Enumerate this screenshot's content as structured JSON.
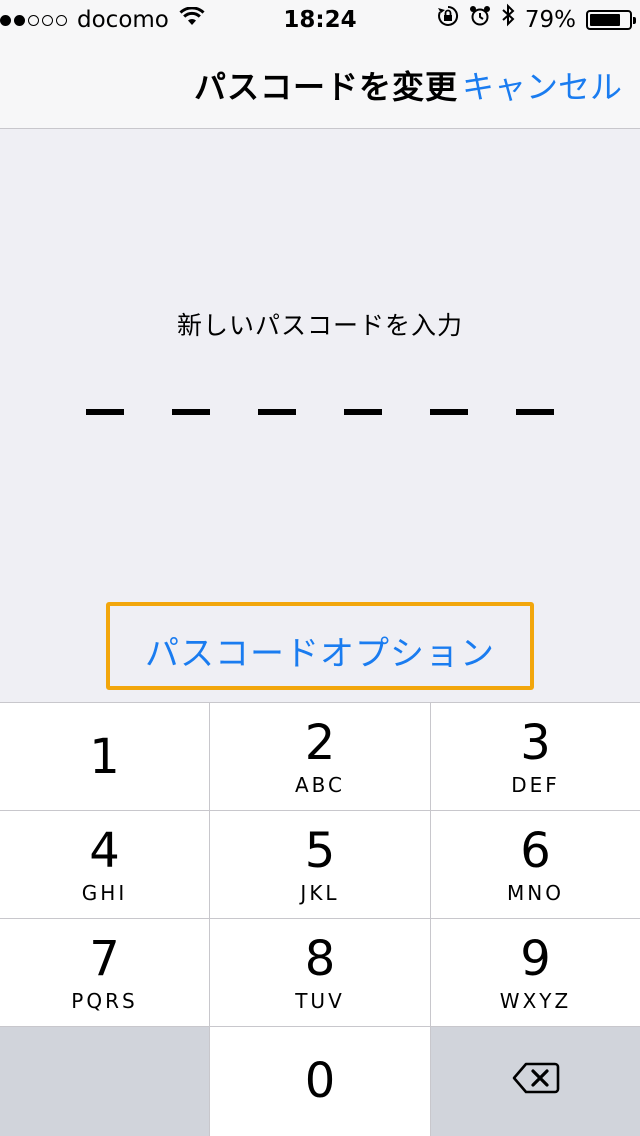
{
  "status_bar": {
    "carrier": "docomo",
    "signal_bars_filled": 2,
    "signal_bars_total": 5,
    "time": "18:24",
    "battery_percent_text": "79%",
    "battery_level": 0.79,
    "icons": [
      "wifi-icon",
      "rotation-lock-icon",
      "alarm-icon",
      "bluetooth-icon",
      "battery-icon"
    ]
  },
  "nav": {
    "title": "パスコードを変更",
    "cancel_label": "キャンセル"
  },
  "passcode": {
    "prompt": "新しいパスコードを入力",
    "digits_total": 6,
    "digits_entered": 0
  },
  "options_link": "パスコードオプション",
  "keypad": {
    "keys": [
      {
        "digit": "1",
        "letters": ""
      },
      {
        "digit": "2",
        "letters": "ABC"
      },
      {
        "digit": "3",
        "letters": "DEF"
      },
      {
        "digit": "4",
        "letters": "GHI"
      },
      {
        "digit": "5",
        "letters": "JKL"
      },
      {
        "digit": "6",
        "letters": "MNO"
      },
      {
        "digit": "7",
        "letters": "PQRS"
      },
      {
        "digit": "8",
        "letters": "TUV"
      },
      {
        "digit": "9",
        "letters": "WXYZ"
      },
      {
        "digit": "0",
        "letters": ""
      }
    ],
    "delete_icon": "backspace-icon"
  },
  "colors": {
    "accent": "#1a7cf0",
    "highlight": "#f2a60c",
    "background": "#efeff4",
    "keypad_dark": "#d1d4db"
  }
}
